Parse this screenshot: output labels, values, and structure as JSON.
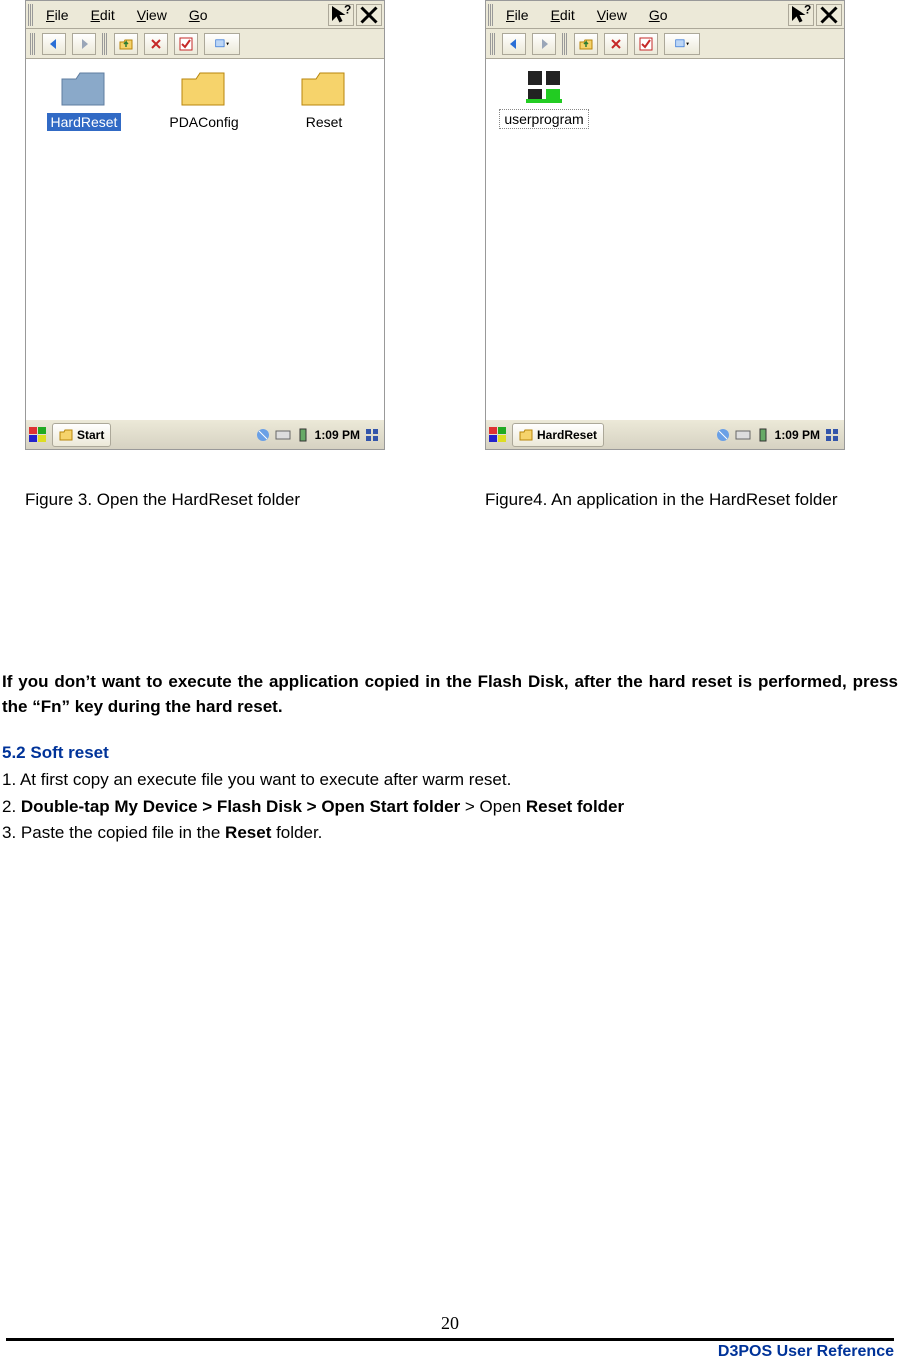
{
  "figures": {
    "left": {
      "menu": [
        "File",
        "Edit",
        "View",
        "Go"
      ],
      "items": [
        {
          "label": "HardReset",
          "selected": true,
          "type": "folder-blue"
        },
        {
          "label": "PDAConfig",
          "type": "folder"
        },
        {
          "label": "Reset",
          "type": "folder"
        }
      ],
      "taskbar_label": "Start",
      "time": "1:09 PM",
      "caption": "Figure 3. Open the HardReset folder"
    },
    "right": {
      "menu": [
        "File",
        "Edit",
        "View",
        "Go"
      ],
      "items": [
        {
          "label": "userprogram",
          "boxed": true,
          "type": "app"
        }
      ],
      "taskbar_label": "HardReset",
      "time": "1:09 PM",
      "caption": "Figure4. An application in the HardReset folder"
    }
  },
  "paragraph1": "If you don’t want to execute the application copied in the Flash Disk, after the hard reset is performed, press the “Fn” key during the hard reset.",
  "section_heading": "5.2 Soft reset",
  "steps": {
    "s1": "1. At first copy an execute file you want to execute after warm reset.",
    "s2_prefix": "2. ",
    "s2_bold": "Double-tap My Device > Flash Disk > Open Start folder",
    "s2_rest_a": " > Open ",
    "s2_rest_b": "Reset folder",
    "s3_a": "3. Paste the copied file in the ",
    "s3_b": "Reset",
    "s3_c": " folder."
  },
  "page_number": "20",
  "footer_ref": "D3POS User Reference"
}
